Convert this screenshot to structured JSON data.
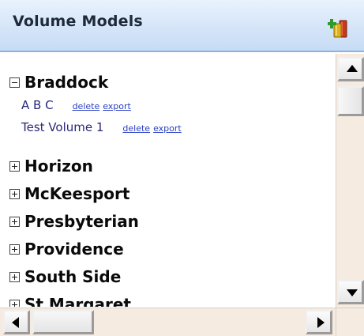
{
  "header": {
    "title": "Volume Models",
    "add_icon": "add-volume-icon"
  },
  "tree": {
    "nodes": [
      {
        "label": "Braddock",
        "expanded": true,
        "children": [
          {
            "name": "A B C",
            "delete_label": "delete",
            "export_label": "export"
          },
          {
            "name": "Test Volume 1",
            "delete_label": "delete",
            "export_label": "export"
          }
        ]
      },
      {
        "label": "Horizon",
        "expanded": false
      },
      {
        "label": "McKeesport",
        "expanded": false
      },
      {
        "label": "Presbyterian",
        "expanded": false
      },
      {
        "label": "Providence",
        "expanded": false
      },
      {
        "label": "South Side",
        "expanded": false
      },
      {
        "label": "St Margaret",
        "expanded": false
      }
    ]
  },
  "colors": {
    "header_bg": "#d5e5f8",
    "scroll_track": "#f6ebe0",
    "link": "#2a3fc4",
    "child_text": "#28287a"
  }
}
